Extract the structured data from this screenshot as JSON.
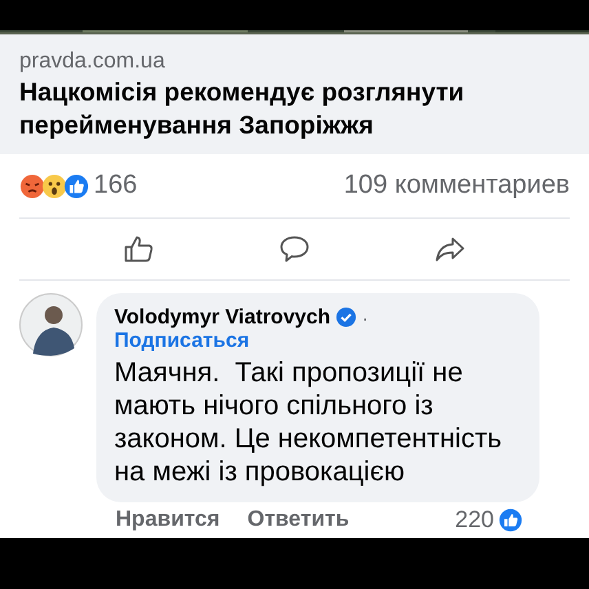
{
  "link": {
    "domain": "pravda.com.ua",
    "title": "Нацкомісія рекомендує розглянути перейменування Запоріжжя"
  },
  "reactions": {
    "count": "166",
    "comments": "109 комментариев"
  },
  "comment": {
    "author": "Volodymyr Viatrovych",
    "verified": true,
    "separator": "·",
    "follow": "Подписаться",
    "text": "Маячня.  Такі пропозиції не мають нічого спільного із законом. Це некомпетентність на межі із провокацією",
    "actions": [
      "Нравится",
      "Ответить"
    ],
    "likes": "220"
  }
}
